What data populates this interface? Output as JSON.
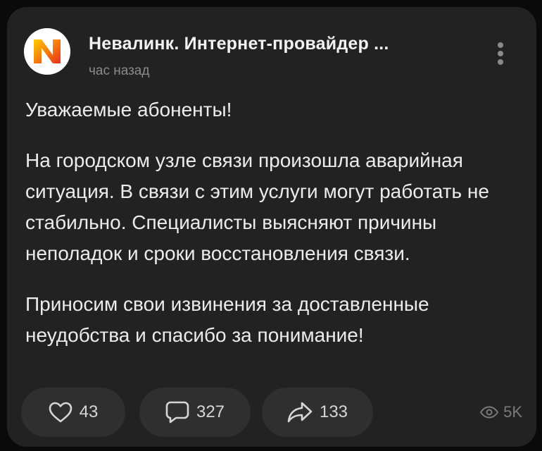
{
  "post": {
    "author": "Невалинк. Интернет-провайдер ...",
    "time": "час назад",
    "avatar_icon": "nevalink-logo",
    "paragraphs": [
      "Уважаемые абоненты!",
      "На городском узле связи произошла аварийная ситуация. В связи с этим  услуги могут работать не стабильно. Специалисты выясняют причины неполадок и сроки восстановления связи.",
      "Приносим свои извинения за доставленные неудобства и спасибо за понимание!"
    ]
  },
  "actions": {
    "likes": "43",
    "comments": "327",
    "shares": "133",
    "views": "5K"
  },
  "colors": {
    "background": "#0a0a0a",
    "card": "#222222",
    "pill": "#2f2f2f",
    "text": "#ececec",
    "muted": "#8a8a8a",
    "logo_gradient_start": "#ffcc00",
    "logo_gradient_end": "#e8301c"
  }
}
